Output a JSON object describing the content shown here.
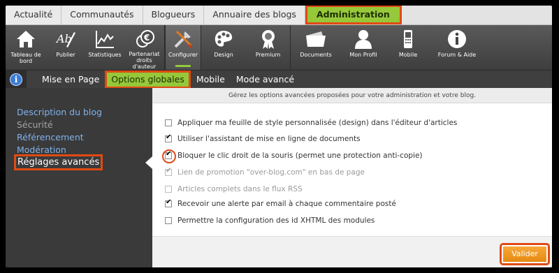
{
  "top_tabs": [
    {
      "label": "Actualité"
    },
    {
      "label": "Communautés"
    },
    {
      "label": "Blogueurs"
    },
    {
      "label": "Annuaire des blogs"
    },
    {
      "label": "Administration"
    }
  ],
  "toolbar": [
    {
      "label": "Tableau de bord",
      "icon": "house-icon"
    },
    {
      "label": "Publier",
      "icon": "pen-writing-icon"
    },
    {
      "label": "Statistiques",
      "icon": "chart-line-icon"
    },
    {
      "label": "Partenariat droits d'auteur",
      "icon": "euro-coins-icon"
    },
    {
      "label": "Configurer",
      "icon": "tools-icon"
    },
    {
      "label": "Design",
      "icon": "palette-icon"
    },
    {
      "label": "Premium",
      "icon": "award-badge-icon"
    },
    {
      "label": "Documents",
      "icon": "folder-icon"
    },
    {
      "label": "Mon Profil",
      "icon": "user-icon"
    },
    {
      "label": "Mobile",
      "icon": "phone-icon"
    },
    {
      "label": "Forum & Aide",
      "icon": "info-icon"
    }
  ],
  "subnav": {
    "tabs": [
      {
        "label": "Mise en Page"
      },
      {
        "label": "Options globales"
      },
      {
        "label": "Mobile"
      },
      {
        "label": "Mode avancé"
      }
    ]
  },
  "sidebar": {
    "items": [
      {
        "label": "Description du blog"
      },
      {
        "label": "Sécurité"
      },
      {
        "label": "Référencement"
      },
      {
        "label": "Modération"
      },
      {
        "label": "Réglages avancés"
      }
    ]
  },
  "main": {
    "header": "Gérez les options avancées proposées pour votre administration et votre blog.",
    "options": [
      {
        "label": "Appliquer ma feuille de style personnalisée (design) dans l'éditeur d'articles",
        "checked": false,
        "disabled": false
      },
      {
        "label": "Utiliser l'assistant de mise en ligne de documents",
        "checked": true,
        "disabled": false
      },
      {
        "label": "Bloquer le clic droit de la souris (permet une protection anti-copie)",
        "checked": true,
        "disabled": false
      },
      {
        "label": "Lien de promotion \"over-blog.com\" en bas de page",
        "checked": true,
        "disabled": true
      },
      {
        "label": "Articles complets dans le flux RSS",
        "checked": false,
        "disabled": true
      },
      {
        "label": "Recevoir une alerte par email à chaque commentaire posté",
        "checked": true,
        "disabled": false
      },
      {
        "label": "Permettre la configuration des id XHTML des modules",
        "checked": false,
        "disabled": false
      }
    ],
    "submit_label": "Valider"
  },
  "colors": {
    "accent_green": "#96c83a",
    "highlight_red": "#e04a14",
    "link_blue": "#7fb2ec",
    "button_orange": "#e68a10"
  }
}
